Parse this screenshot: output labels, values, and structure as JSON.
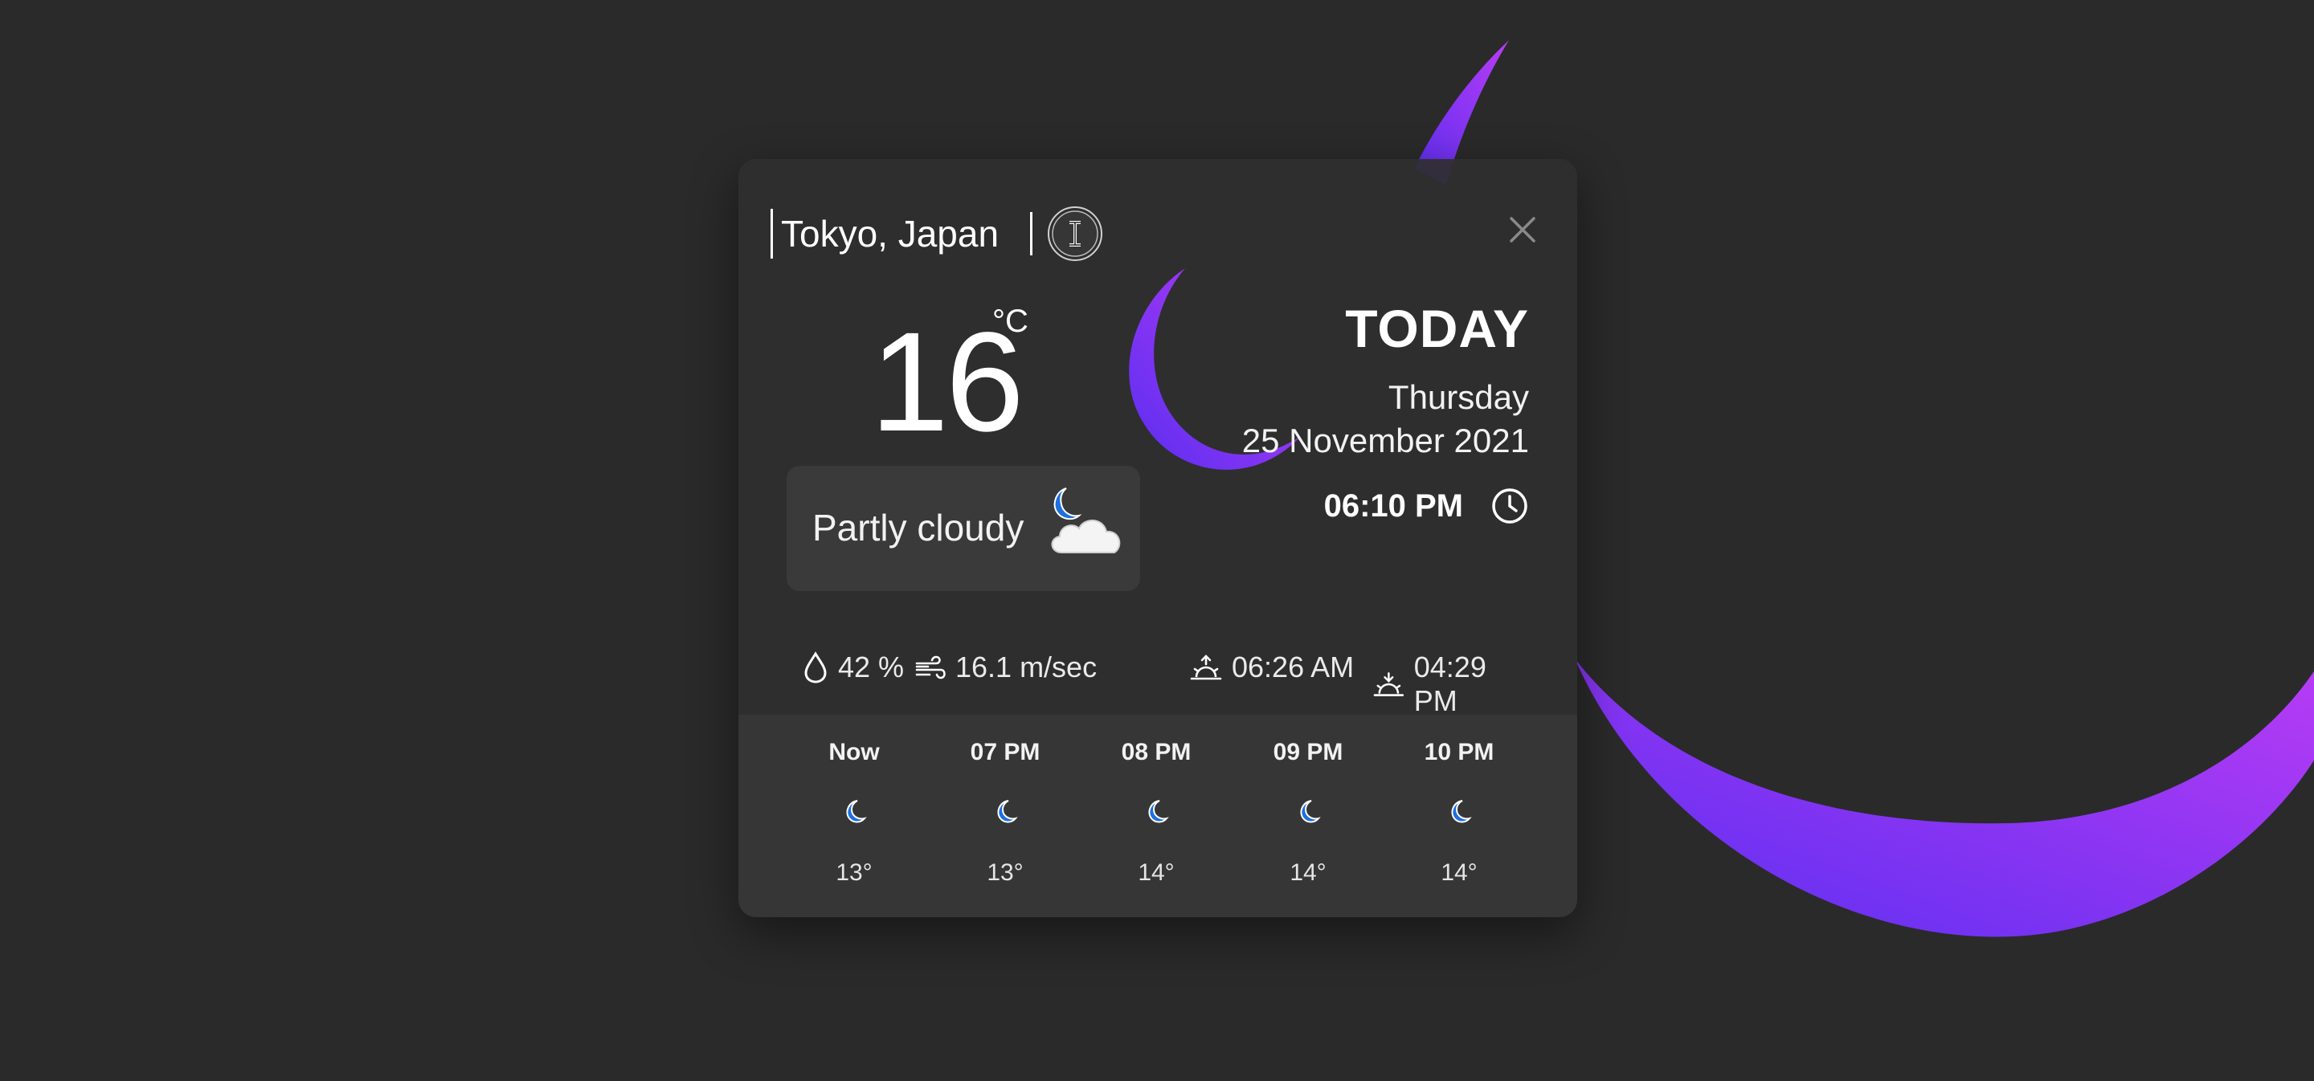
{
  "search": {
    "city_value": "Tokyo, Japan",
    "close_icon": "close-icon",
    "cursor_icon": "text-cursor-icon"
  },
  "current": {
    "temperature": "16",
    "unit": "°C",
    "condition": "Partly cloudy",
    "condition_icon": "partly-cloudy-night-icon"
  },
  "today": {
    "title": "TODAY",
    "day": "Thursday",
    "date": "25 November 2021",
    "time": "06:10 PM",
    "clock_icon": "clock-icon"
  },
  "stats": {
    "humidity": "42 %",
    "wind": "16.1 m/sec",
    "sunrise": "06:26 AM",
    "sunset": "04:29 PM"
  },
  "forecast": [
    {
      "time": "Now",
      "temp": "13°",
      "icon": "moon-icon"
    },
    {
      "time": "07 PM",
      "temp": "13°",
      "icon": "moon-icon"
    },
    {
      "time": "08 PM",
      "temp": "14°",
      "icon": "moon-icon"
    },
    {
      "time": "09 PM",
      "temp": "14°",
      "icon": "moon-icon"
    },
    {
      "time": "10 PM",
      "temp": "14°",
      "icon": "moon-icon"
    }
  ],
  "colors": {
    "background": "#2a2a2a",
    "card": "#2e2e2e",
    "accent_start": "#6a2cf0",
    "accent_end": "#b23cf5",
    "moon_icon": "#1e6fe0"
  }
}
